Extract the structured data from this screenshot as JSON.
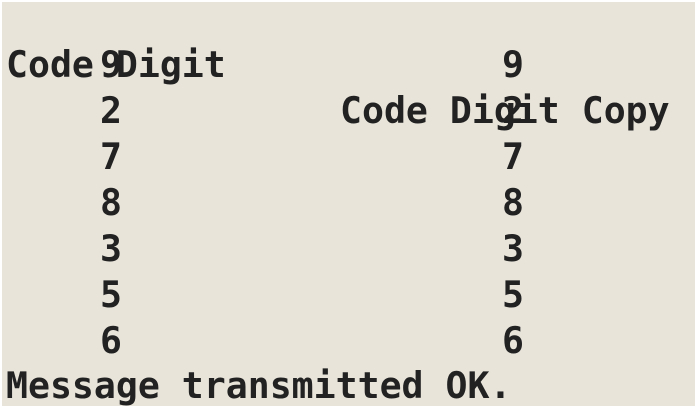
{
  "headers": {
    "col1": "Code Digit",
    "col2": "Code Digit Copy"
  },
  "rows": [
    {
      "digit": "9",
      "copy": "9"
    },
    {
      "digit": "2",
      "copy": "2"
    },
    {
      "digit": "7",
      "copy": "7"
    },
    {
      "digit": "8",
      "copy": "8"
    },
    {
      "digit": "3",
      "copy": "3"
    },
    {
      "digit": "5",
      "copy": "5"
    },
    {
      "digit": "6",
      "copy": "6"
    }
  ],
  "status": "Message transmitted OK."
}
